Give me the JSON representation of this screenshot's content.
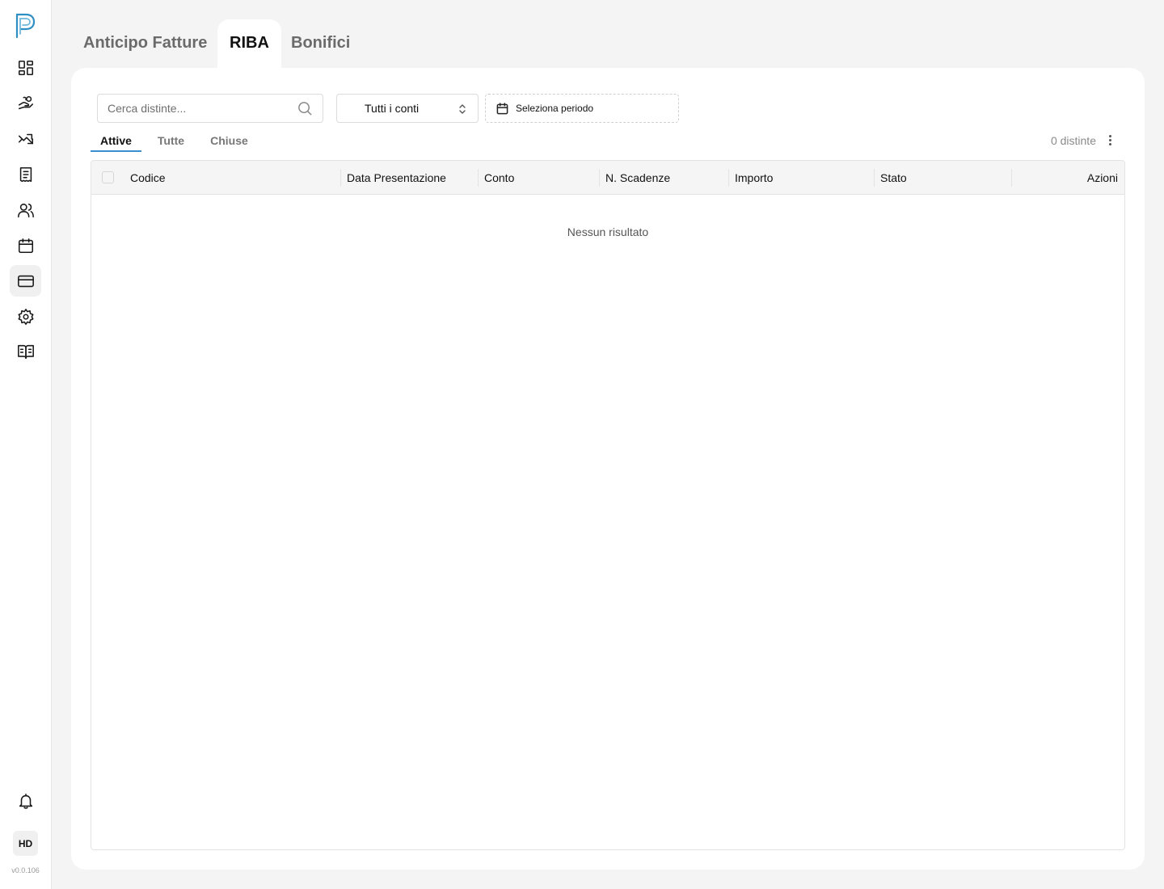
{
  "sidebar": {
    "items": [
      {
        "icon": "dashboard-icon"
      },
      {
        "icon": "hand-coins-icon"
      },
      {
        "icon": "trending-icon"
      },
      {
        "icon": "receipt-icon"
      },
      {
        "icon": "users-icon"
      },
      {
        "icon": "calendar-icon"
      },
      {
        "icon": "credit-card-icon"
      },
      {
        "icon": "settings-icon"
      },
      {
        "icon": "book-icon"
      }
    ],
    "bell_icon": "bell-icon",
    "avatar": "HD",
    "version": "v0.0.106"
  },
  "top_tabs": [
    "Anticipo Fatture",
    "RIBA",
    "Bonifici"
  ],
  "active_top_tab": "RIBA",
  "filters": {
    "search_placeholder": "Cerca distinte...",
    "search_value": "",
    "account_select": "Tutti i conti",
    "period_label": "Seleziona periodo"
  },
  "sub_tabs": [
    "Attive",
    "Tutte",
    "Chiuse"
  ],
  "active_sub_tab": "Attive",
  "count_label": "0 distinte",
  "table": {
    "columns": [
      "Codice",
      "Data Presentazione",
      "Conto",
      "N. Scadenze",
      "Importo",
      "Stato",
      "Azioni"
    ],
    "rows": [],
    "empty_message": "Nessun risultato"
  },
  "colors": {
    "accent": "#3a8fd0",
    "background": "#f4f4f4",
    "card": "#ffffff"
  }
}
